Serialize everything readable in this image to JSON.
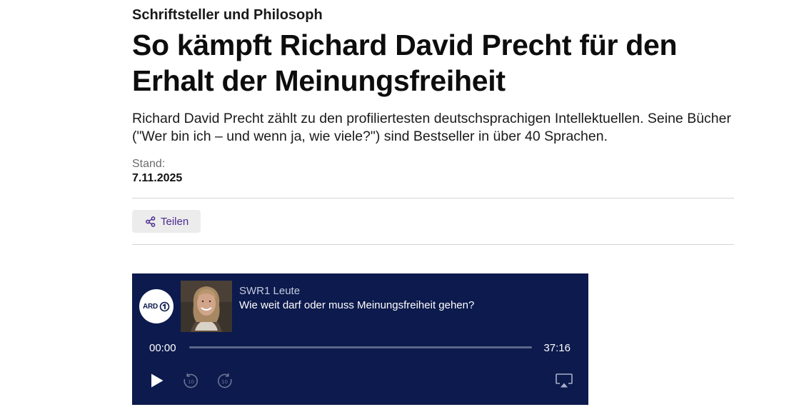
{
  "article": {
    "kicker": "Schriftsteller und Philosoph",
    "headline": "So kämpft Richard David Precht für den Er­halt der Meinungsfreiheit",
    "teaser": "Richard David Precht zählt zu den profiliertesten deutschsprachigen Intellektuellen. Seine Bücher (\"Wer bin ich – und wenn ja, wie viele?\") sind Bestseller in über 40 Sprachen.",
    "stand_label": "Stand:",
    "stand_date": "7.11.2025"
  },
  "share": {
    "label": "Teilen",
    "icon": "share-icon",
    "color": "#4c2a8f"
  },
  "player": {
    "logo_text": "ARD",
    "show_name": "SWR1 Leute",
    "episode_title": "Wie weit darf oder muss Meinungsfreiheit gehen?",
    "time_current": "00:00",
    "time_total": "37:16",
    "progress": 0,
    "background": "#0c1a4d",
    "icons": {
      "play": "play-icon",
      "rewind": "rewind-10-icon",
      "forward": "forward-10-icon",
      "airplay": "airplay-icon"
    }
  }
}
